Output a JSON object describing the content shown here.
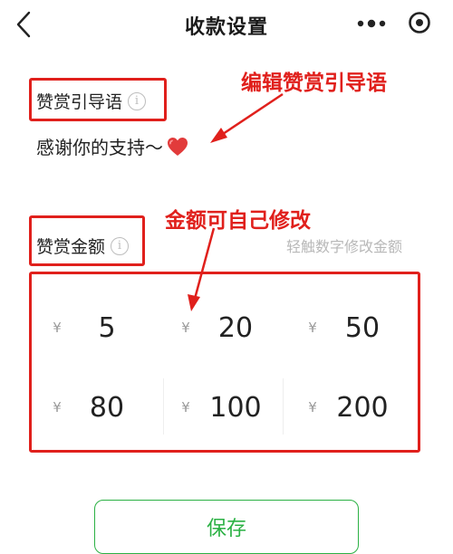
{
  "header": {
    "title": "收款设置",
    "back_icon": "chevron-left-icon",
    "more_icon": "more-dots-icon",
    "close_icon": "target-circle-icon"
  },
  "guide": {
    "label": "赞赏引导语",
    "info_icon_glyph": "i",
    "text": "感谢你的支持～",
    "emoji": "red-heart-icon"
  },
  "amounts": {
    "label": "赞赏金额",
    "info_icon_glyph": "i",
    "hint": "轻触数字修改金额",
    "currency": "¥",
    "values": [
      "5",
      "20",
      "50",
      "80",
      "100",
      "200"
    ]
  },
  "annotations": {
    "guide_note": "编辑赞赏引导语",
    "amount_note": "金额可自己修改",
    "color": "#e0201c"
  },
  "footer": {
    "save_label": "保存",
    "accent": "#2bb144"
  }
}
